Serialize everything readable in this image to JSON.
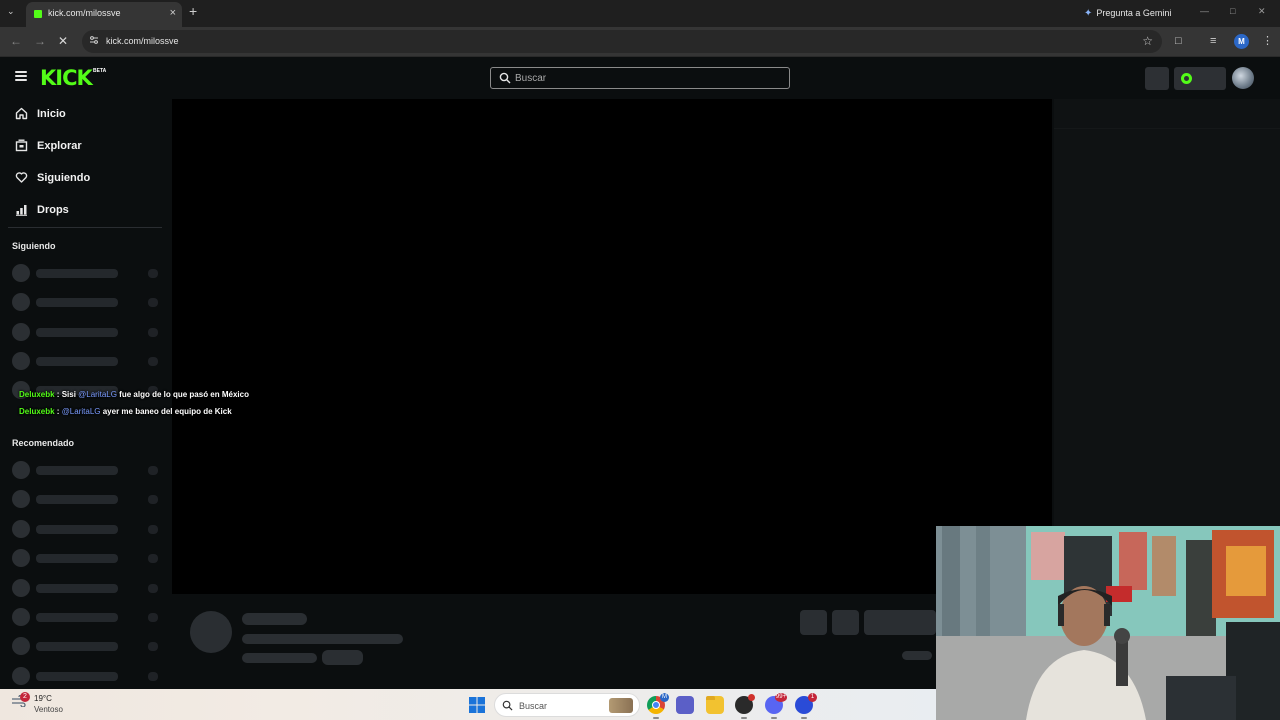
{
  "browser": {
    "tab": {
      "title": "kick.com/milossve"
    },
    "gemini_label": "Pregunta a Gemini",
    "address": "kick.com/milossve",
    "profile_initial": "M"
  },
  "kick": {
    "logo": "KICK",
    "logo_badge": "BETA",
    "search_placeholder": "Buscar",
    "nav": [
      {
        "label": "Inicio",
        "icon": "home-icon"
      },
      {
        "label": "Explorar",
        "icon": "explore-icon"
      },
      {
        "label": "Siguiendo",
        "icon": "heart-icon"
      },
      {
        "label": "Drops",
        "icon": "drops-icon"
      }
    ],
    "sections": {
      "following": "Siguiendo",
      "recommended": "Recomendado"
    },
    "overlay_chat": [
      {
        "user": "Deluxebk",
        "sep": " : ",
        "pre": "Sisi ",
        "mention": "@LaritaLG",
        "post": " fue algo de lo que pasó en México"
      },
      {
        "user": "Deluxebk",
        "sep": " : ",
        "pre": "",
        "mention": "@LaritaLG",
        "post": " ayer me baneo del equipo de Kick"
      }
    ],
    "accent_color": "#53fc18"
  },
  "taskbar": {
    "weather_temp": "19°C",
    "weather_condition": "Ventoso",
    "weather_badge": "2",
    "search_placeholder": "Buscar",
    "apps": [
      {
        "name": "chrome",
        "badge": "M"
      },
      {
        "name": "teams",
        "badge": ""
      },
      {
        "name": "file-explorer",
        "badge": ""
      },
      {
        "name": "app-dark",
        "badge": ""
      },
      {
        "name": "discord",
        "badge": "99+"
      },
      {
        "name": "ea-app",
        "badge": "1"
      }
    ]
  }
}
